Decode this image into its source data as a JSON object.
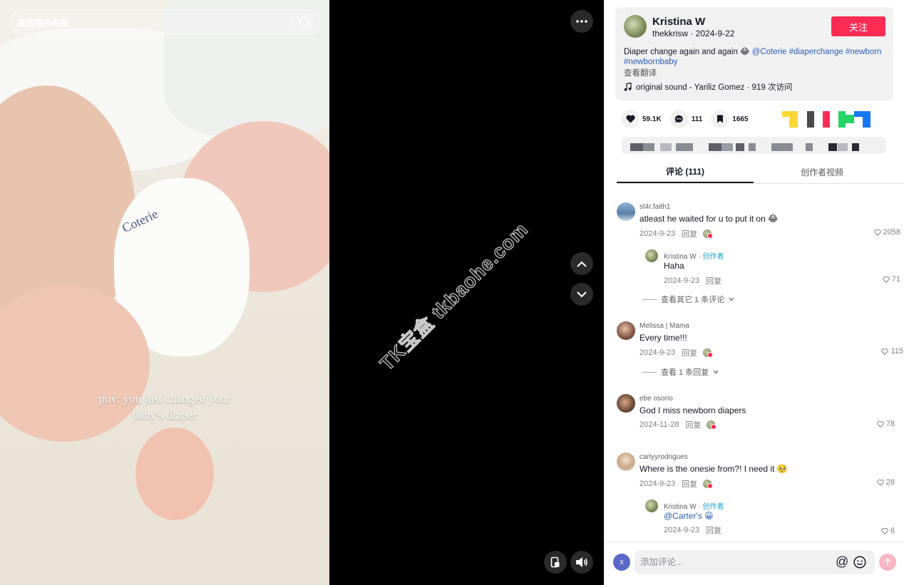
{
  "search": {
    "placeholder": "查找相关内容"
  },
  "video": {
    "caption": "pov: you just changed your\nbaby's diaper",
    "watermark": "TK宝盒 tkbaohe.com"
  },
  "author": {
    "name": "Kristina W",
    "meta": "thekkrisw · 2024-9-22",
    "follow_label": "关注"
  },
  "description": {
    "text": "Diaper change again and again 😂 ",
    "tags": [
      "@Coterie",
      "#diaperchange",
      "#newborn",
      "#newbornbaby"
    ],
    "translate": "查看翻译",
    "music": "original sound - Yariliz Gomez · 919 次访问"
  },
  "stats": {
    "likes": "59.1K",
    "comments": "111",
    "saves": "1665"
  },
  "tabs": {
    "comments": "评论 (111)",
    "creator": "创作者视频"
  },
  "comments": [
    {
      "user": "st4r.faith1",
      "text": "atleast he waited for u to put it on 😂",
      "date": "2024-9-23",
      "reply": "回复",
      "likes": "2058",
      "replies": [
        {
          "user": "Kristina W",
          "creator_tag": " · 创作者",
          "text": "Haha",
          "date": "2024-9-23",
          "reply": "回复",
          "likes": "71"
        }
      ],
      "more": "查看其它 1 条评论"
    },
    {
      "user": "Melissa | Mama",
      "text": "Every time!!!",
      "date": "2024-9-23",
      "reply": "回复",
      "likes": "115",
      "more": "查看 1 条回复"
    },
    {
      "user": "ebe osorio",
      "text": "God I miss newborn diapers",
      "date": "2024-11-28",
      "reply": "回复",
      "likes": "78"
    },
    {
      "user": "carlyyrodrigues",
      "text": "Where is the onesie from?! I need it 🥺",
      "date": "2024-9-23",
      "reply": "回复",
      "likes": "28",
      "replies": [
        {
          "user": "Kristina W",
          "creator_tag": " · 创作者",
          "text": "@Carter's 😀",
          "date": "2024-9-23",
          "reply": "回复",
          "likes": "6"
        }
      ]
    }
  ],
  "comment_bar": {
    "avatar_letter": "x",
    "placeholder": "添加评论...",
    "mention": "@"
  },
  "colors": {
    "accent": "#fe2c55",
    "link": "#2b5db9",
    "creator": "#1ba5c5"
  }
}
